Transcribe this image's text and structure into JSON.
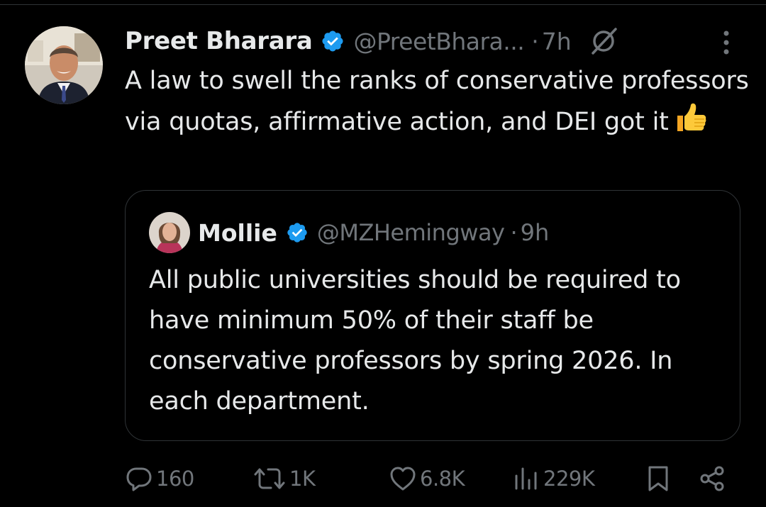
{
  "tweet": {
    "author_name": "Preet Bharara",
    "author_handle": "@PreetBhara...",
    "separator": "·",
    "time": "7h",
    "text": "A law to swell the ranks of conservative professors via quotas, affirmative action, and DEI got it",
    "emoji": "thumbs-up",
    "verified": true
  },
  "quoted_tweet": {
    "author_name": "Mollie",
    "author_handle": "@MZHemingway",
    "separator": "·",
    "time": "9h",
    "text": "All public universities should be required to have minimum 50% of their staff be conservative professors by spring 2026. In each department.",
    "verified": true
  },
  "actions": {
    "replies": "160",
    "reposts": "1K",
    "likes": "6.8K",
    "views": "229K"
  },
  "colors": {
    "background": "#000000",
    "text_primary": "#e7e9ea",
    "text_secondary": "#71767b",
    "verified_blue": "#1d9bf0",
    "border": "#2f3336"
  },
  "icons": {
    "verified": "verified-badge-icon",
    "grok": "grok-icon",
    "more": "more-vertical-icon",
    "reply": "reply-icon",
    "repost": "repost-icon",
    "like": "heart-icon",
    "views": "views-chart-icon",
    "bookmark": "bookmark-icon",
    "share": "share-icon"
  }
}
